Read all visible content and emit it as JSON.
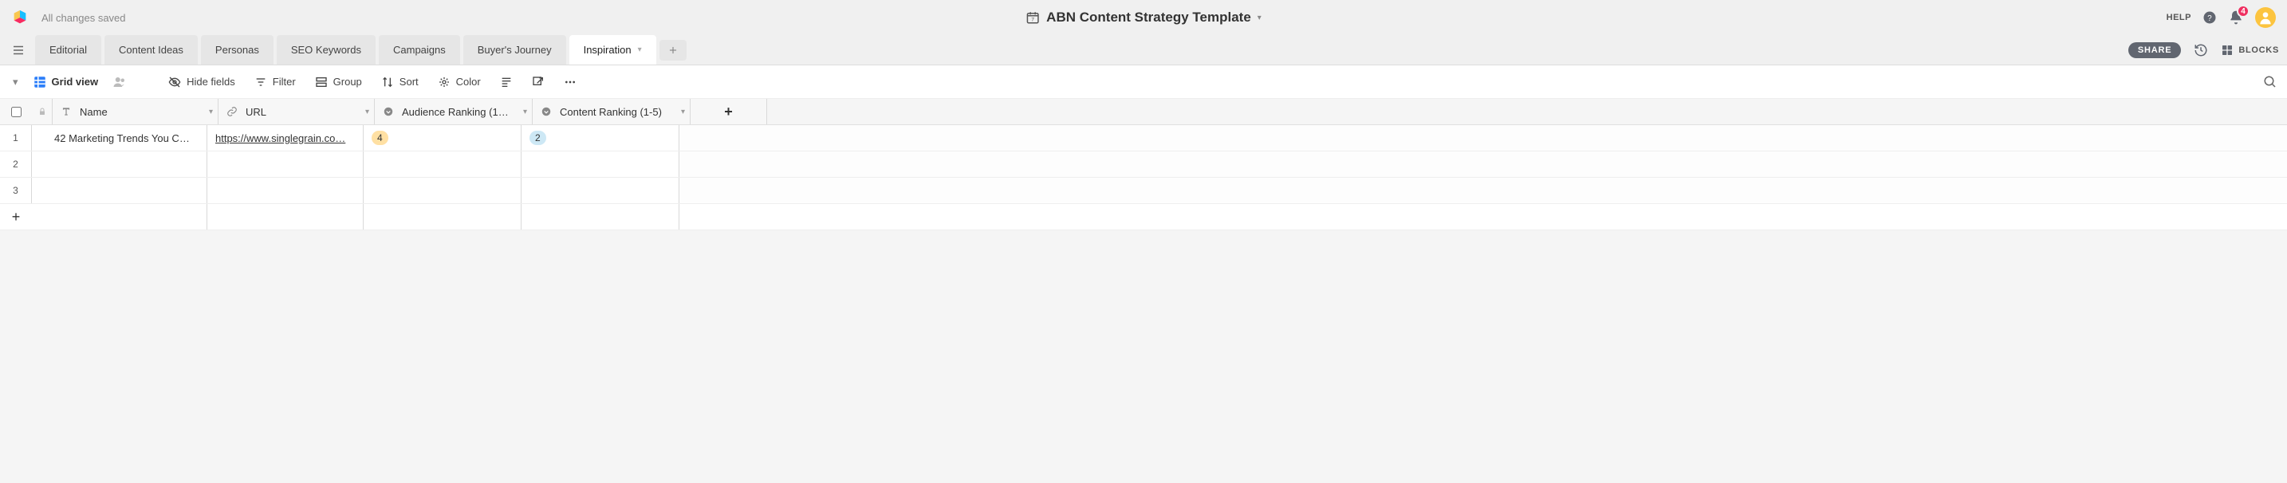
{
  "header": {
    "saved_text": "All changes saved",
    "title": "ABN Content Strategy Template",
    "help_label": "HELP",
    "notification_count": "4"
  },
  "tabs": {
    "items": [
      {
        "label": "Editorial"
      },
      {
        "label": "Content Ideas"
      },
      {
        "label": "Personas"
      },
      {
        "label": "SEO Keywords"
      },
      {
        "label": "Campaigns"
      },
      {
        "label": "Buyer's Journey"
      },
      {
        "label": "Inspiration"
      }
    ],
    "active_index": 6,
    "share_label": "SHARE",
    "blocks_label": "BLOCKS"
  },
  "toolbar": {
    "view_label": "Grid view",
    "hide_fields": "Hide fields",
    "filter": "Filter",
    "group": "Group",
    "sort": "Sort",
    "color": "Color"
  },
  "columns": {
    "name": "Name",
    "url": "URL",
    "audience": "Audience Ranking (1…",
    "content": "Content Ranking (1-5)"
  },
  "rows": [
    {
      "num": "1",
      "name": "42 Marketing Trends You C…",
      "url": "https://www.singlegrain.co…",
      "audience": "4",
      "audience_color": "yellow",
      "content": "2",
      "content_color": "cyan"
    },
    {
      "num": "2",
      "name": "",
      "url": "",
      "audience": "",
      "content": ""
    },
    {
      "num": "3",
      "name": "",
      "url": "",
      "audience": "",
      "content": ""
    }
  ]
}
